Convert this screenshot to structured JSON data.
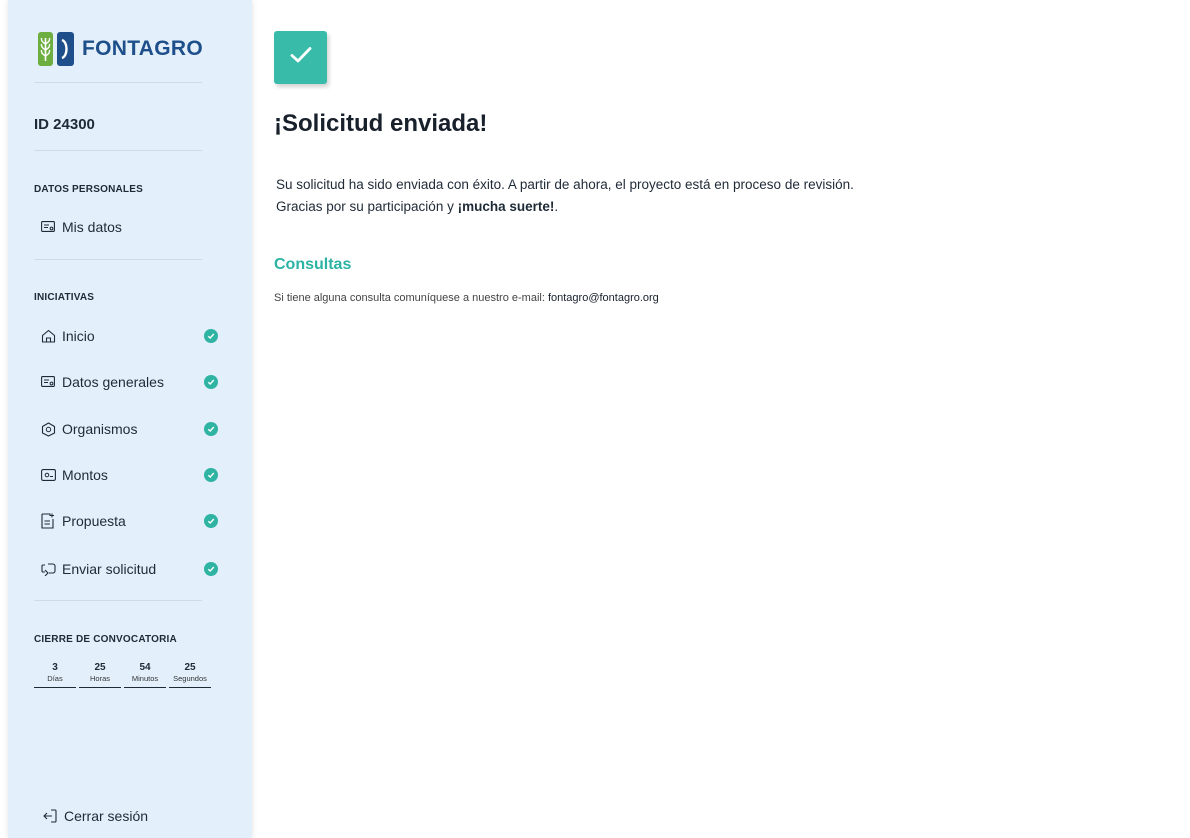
{
  "brand": {
    "name": "FONTAGRO",
    "colors": {
      "primary": "#1e4f8a",
      "accent": "#2fb3a3",
      "sidebar_bg": "#e3f0fb",
      "leaf_green": "#6cae3f"
    }
  },
  "sidebar": {
    "id_label": "ID 24300",
    "personal_section": {
      "title": "DATOS PERSONALES",
      "items": [
        {
          "label": "Mis datos",
          "icon": "id-card-icon"
        }
      ]
    },
    "initiatives_section": {
      "title": "INICIATIVAS",
      "items": [
        {
          "label": "Inicio",
          "icon": "home-icon",
          "completed": true
        },
        {
          "label": "Datos generales",
          "icon": "id-card-icon",
          "completed": true
        },
        {
          "label": "Organismos",
          "icon": "building-icon",
          "completed": true
        },
        {
          "label": "Montos",
          "icon": "money-icon",
          "completed": true
        },
        {
          "label": "Propuesta",
          "icon": "document-add-icon",
          "completed": true
        },
        {
          "label": "Enviar solicitud",
          "icon": "send-icon",
          "completed": true
        }
      ]
    },
    "countdown": {
      "title": "CIERRE DE CONVOCATORIA",
      "units": [
        {
          "value": "3",
          "label": "Días"
        },
        {
          "value": "25",
          "label": "Horas"
        },
        {
          "value": "54",
          "label": "Minutos"
        },
        {
          "value": "25",
          "label": "Segundos"
        }
      ]
    },
    "logout_label": "Cerrar sesión"
  },
  "main": {
    "status_icon": "check-icon",
    "title": "¡Solicitud enviada!",
    "message_line1": "Su solicitud ha sido enviada con éxito. A partir de ahora, el proyecto está en proceso de revisión.",
    "message_line2_prefix": "Gracias por su participación y ",
    "message_line2_bold": "¡mucha suerte!",
    "message_line2_suffix": ".",
    "contact_title": "Consultas",
    "contact_text": "Si tiene alguna consulta comuníquese a nuestro e-mail: ",
    "contact_email": "fontagro@fontagro.org"
  }
}
